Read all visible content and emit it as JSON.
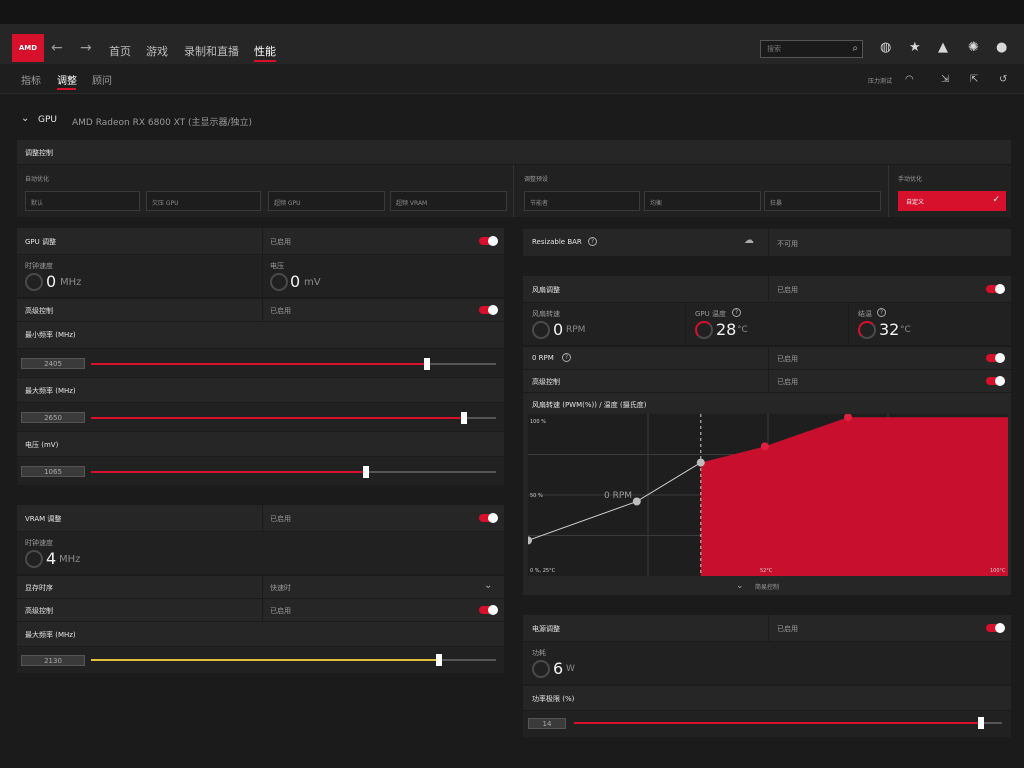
{
  "nav": {
    "tabs": [
      {
        "label": "首页"
      },
      {
        "label": "游戏"
      },
      {
        "label": "录制和直播"
      },
      {
        "label": "性能"
      }
    ],
    "search_placeholder": "搜索",
    "logo": "AMD"
  },
  "subnav": {
    "tabs": [
      {
        "label": "指标"
      },
      {
        "label": "调整"
      },
      {
        "label": "顾问"
      }
    ],
    "stress_test": "压力测试"
  },
  "gpu_header": {
    "label": "GPU",
    "device": "AMD Radeon RX 6800 XT (主显示器/独立)"
  },
  "tuning_control": {
    "title": "调整控制",
    "auto_label": "自动优化",
    "auto_buttons": [
      "默认",
      "欠压 GPU",
      "超频 GPU",
      "超频 VRAM"
    ],
    "preset_label": "调整预设",
    "preset_buttons": [
      "节能者",
      "均衡",
      "狂暴"
    ],
    "manual_label": "手动优化",
    "manual_button": "自定义"
  },
  "gpu_tuning": {
    "title": "GPU 调整",
    "status": "已启用",
    "clock_label": "时钟速度",
    "clock_value": "0",
    "clock_unit": "MHz",
    "voltage_label": "电压",
    "voltage_value": "0",
    "voltage_unit": "mV",
    "advanced_label": "高级控制",
    "advanced_status": "已启用",
    "min_freq_label": "最小频率 (MHz)",
    "min_freq_value": "2405",
    "min_freq_level": 0.83,
    "max_freq_label": "最大频率 (MHz)",
    "max_freq_value": "2650",
    "max_freq_level": 0.92,
    "volt_label": "电压 (mV)",
    "volt_value": "1065",
    "volt_level": 0.68
  },
  "vram_tuning": {
    "title": "VRAM 调整",
    "status": "已启用",
    "clock_label": "时钟速度",
    "clock_value": "4",
    "clock_unit": "MHz",
    "timing_label": "显存时序",
    "timing_value": "快速时",
    "advanced_label": "高级控制",
    "advanced_status": "已启用",
    "max_freq_label": "最大频率 (MHz)",
    "max_freq_value": "2130",
    "max_freq_level": 0.86
  },
  "resizable_bar": {
    "label": "Resizable BAR",
    "status": "不可用"
  },
  "fan_tuning": {
    "title": "风扇调整",
    "status": "已启用",
    "fan_speed_label": "风扇转速",
    "fan_speed_value": "0",
    "fan_speed_unit": "RPM",
    "gpu_temp_label": "GPU 温度",
    "gpu_temp_value": "28",
    "gpu_temp_unit": "°C",
    "junction_label": "结温",
    "junction_value": "32",
    "junction_unit": "°C",
    "zero_rpm_label": "0 RPM",
    "zero_rpm_status": "已启用",
    "advanced_label": "高级控制",
    "advanced_status": "已启用",
    "curve_label": "风扇转速 (PWM(%)) / 温度 (摄氏度)",
    "simple_control": "简易控制"
  },
  "chart_data": {
    "type": "line",
    "title": "风扇转速 (PWM(%)) / 温度 (摄氏度)",
    "x": [
      25,
      42,
      52,
      62,
      75
    ],
    "values": [
      22,
      46,
      70,
      80,
      98
    ],
    "xlim": [
      25,
      100
    ],
    "ylim": [
      0,
      100
    ],
    "tick_labels": {
      "y_top": "100 %",
      "y_mid": "50 %",
      "origin": "0 %, 25°C",
      "x_mid": "52°C",
      "x_end": "100°C"
    },
    "zero_rpm_label": "0 RPM",
    "zero_rpm_threshold": 52,
    "fill_color": "#c8102e"
  },
  "power_tuning": {
    "title": "电源调整",
    "status": "已启用",
    "power_label": "功耗",
    "power_value": "6",
    "power_unit": "W",
    "limit_label": "功率极限 (%)",
    "limit_value": "14",
    "limit_level": 0.95
  },
  "colors": {
    "accent": "#d7102c",
    "vram_slider": "#e3c03a"
  }
}
